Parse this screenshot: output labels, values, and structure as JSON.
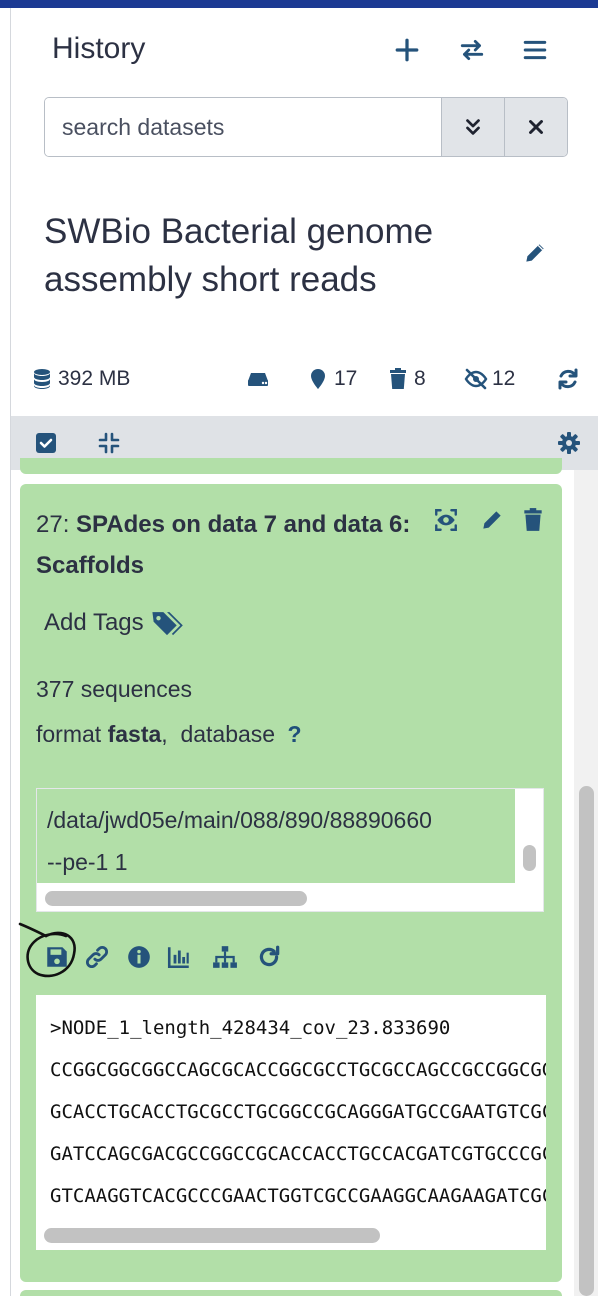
{
  "colors": {
    "accent": "#1c3a93",
    "icon": "#25537b",
    "card_green": "#b2dfa8",
    "toolbar_gray": "#dfe2e6"
  },
  "header": {
    "title": "History",
    "icons": [
      "plus-icon",
      "exchange-icon",
      "bars-icon"
    ]
  },
  "search": {
    "placeholder": "search datasets",
    "value": "",
    "icons": [
      "angle-double-down-icon",
      "times-icon"
    ]
  },
  "history": {
    "name": "SWBio Bacterial genome assembly short reads"
  },
  "stats": {
    "size": "392 MB",
    "shown": "17",
    "deleted": "8",
    "hidden": "12"
  },
  "dataset": {
    "hid": "27:",
    "title": "SPAdes on data 7 and data 6: Scaffolds",
    "add_tags": "Add Tags",
    "sequences": "377 sequences",
    "format_label": "format",
    "format_value": "fasta",
    "database_label": "database",
    "database_value": "?",
    "command_lines": [
      "/data/jwd05e/main/088/890/88890660",
      "--pe-1 1"
    ],
    "peek_lines": [
      ">NODE_1_length_428434_cov_23.833690",
      "CCGGCGGCGGCCAGCGCACCGGCGCCTGCGCCAGCCGCCGGCGG",
      "GCACCTGCACCTGCGCCTGCGGCCGCAGGGATGCCGAATGTCGC",
      "GATCCAGCGACGCCGGCCGCACCACCTGCCACGATCGTGCCCGC",
      "GTCAAGGTCACGCCCGAACTGGTCGCCGAAGGCAAGAAGATCGC"
    ]
  }
}
